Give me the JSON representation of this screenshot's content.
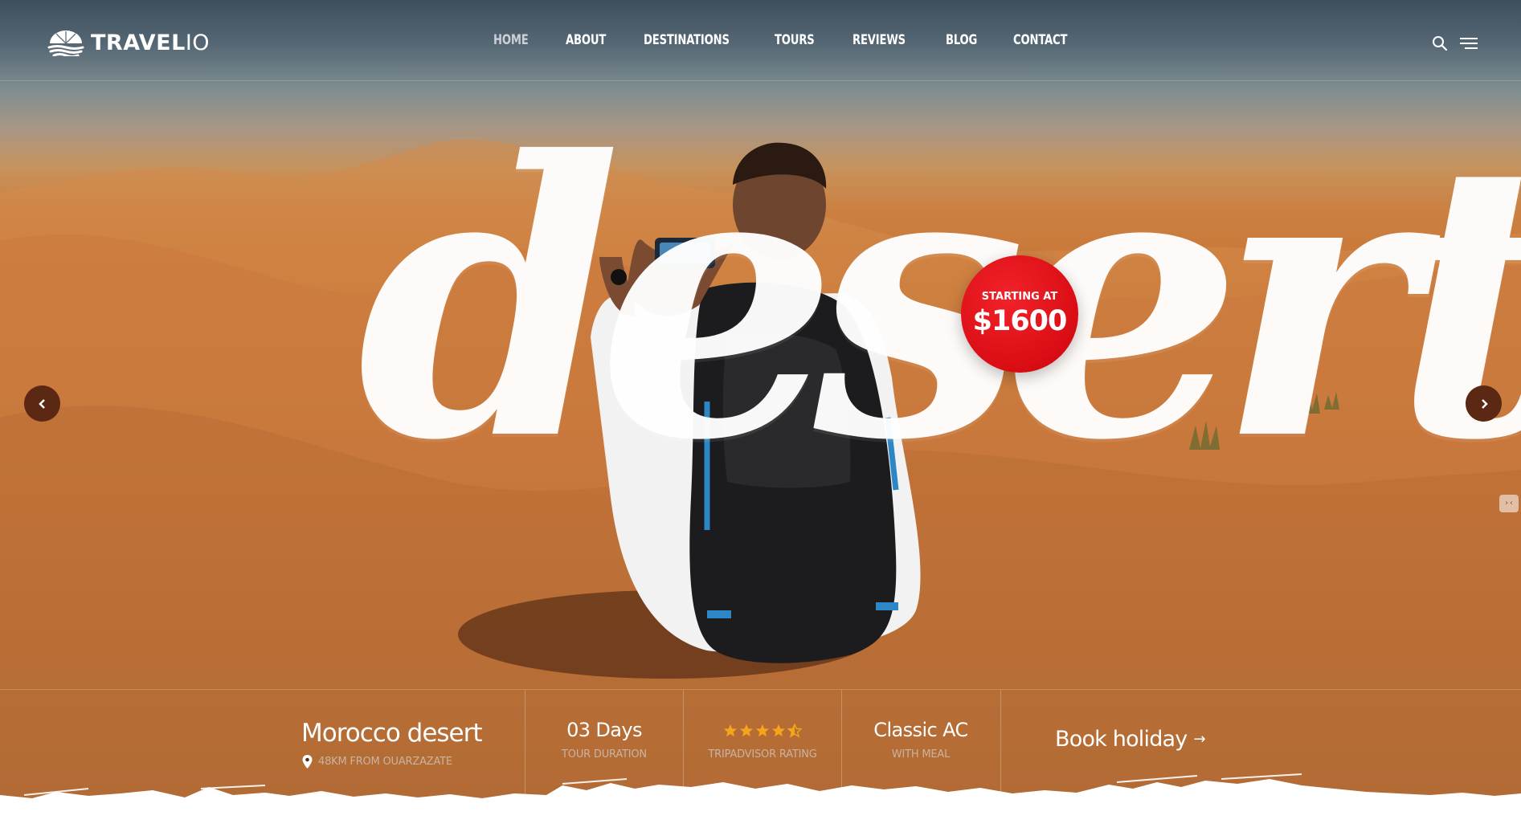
{
  "brand": {
    "name_bold": "TRAVEL",
    "name_thin": "IO"
  },
  "nav": {
    "items": [
      {
        "label": "HOME",
        "active": true
      },
      {
        "label": "ABOUT",
        "active": false
      },
      {
        "label": "DESTINATIONS",
        "active": false
      },
      {
        "label": "TOURS",
        "active": false
      },
      {
        "label": "REVIEWS",
        "active": false
      },
      {
        "label": "BLOG",
        "active": false
      },
      {
        "label": "CONTACT",
        "active": false
      }
    ]
  },
  "hero": {
    "script_word": "desert",
    "badge": {
      "top": "STARTING AT",
      "price": "$1600"
    }
  },
  "tour": {
    "title": "Morocco desert",
    "location": "48KM FROM OUARZAZATE"
  },
  "stats": [
    {
      "value": "03 Days",
      "label": "TOUR DURATION"
    },
    {
      "value": "",
      "label": "TRIPADVISOR RATING",
      "rating": 4.5,
      "max": 5
    },
    {
      "value": "Classic AC",
      "label": "WITH MEAL"
    }
  ],
  "cta": {
    "label": "Book holiday",
    "arrow": "→"
  },
  "icons": {
    "search": "search-icon",
    "menu": "hamburger-menu-icon",
    "prev": "chevron-left-icon",
    "next": "chevron-right-icon",
    "pin": "map-pin-icon",
    "star": "star-icon",
    "logo": "sun-waves-logo-icon"
  },
  "colors": {
    "badge": "#d90d14",
    "stars": "#f4a51c",
    "arrow_bg": "#5b2813"
  }
}
